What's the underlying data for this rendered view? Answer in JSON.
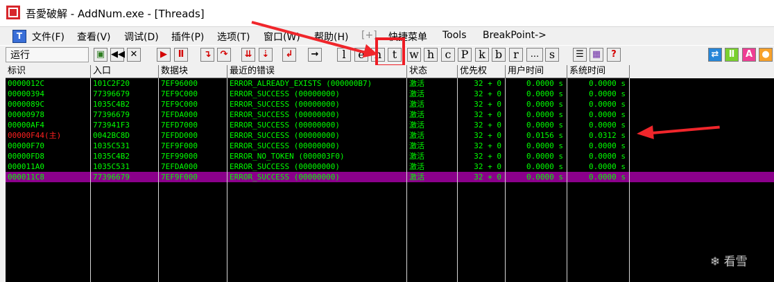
{
  "window": {
    "title": "吾愛破解 - AddNum.exe - [Threads]"
  },
  "menu": {
    "items": [
      "文件(F)",
      "查看(V)",
      "调试(D)",
      "插件(P)",
      "选项(T)",
      "窗口(W)",
      "帮助(H)",
      "[+]",
      "快捷菜单",
      "Tools",
      "BreakPoint->"
    ]
  },
  "toolbar": {
    "status": "运行",
    "letters": [
      "l",
      "e",
      "n",
      "t",
      "w",
      "h",
      "c",
      "P",
      "k",
      "b",
      "r",
      "...",
      "s"
    ]
  },
  "table": {
    "columns": [
      "标识",
      "入口",
      "数据块",
      "最近的错误",
      "状态",
      "优先权",
      "用户时间",
      "系统时间"
    ],
    "rows": [
      {
        "id": "0000012C",
        "entry": "101C2F20",
        "teb": "7EF96000",
        "error": "ERROR_ALREADY_EXISTS (000000B7)",
        "status": "激活",
        "priority": "32 + 0",
        "user": "0.0000 s",
        "sys": "0.0000 s",
        "main": false,
        "selected": false
      },
      {
        "id": "00000394",
        "entry": "77396679",
        "teb": "7EF9C000",
        "error": "ERROR_SUCCESS (00000000)",
        "status": "激活",
        "priority": "32 + 0",
        "user": "0.0000 s",
        "sys": "0.0000 s",
        "main": false,
        "selected": false
      },
      {
        "id": "0000089C",
        "entry": "1035C4B2",
        "teb": "7EF9C000",
        "error": "ERROR_SUCCESS (00000000)",
        "status": "激活",
        "priority": "32 + 0",
        "user": "0.0000 s",
        "sys": "0.0000 s",
        "main": false,
        "selected": false
      },
      {
        "id": "00000978",
        "entry": "77396679",
        "teb": "7EFDA000",
        "error": "ERROR_SUCCESS (00000000)",
        "status": "激活",
        "priority": "32 + 0",
        "user": "0.0000 s",
        "sys": "0.0000 s",
        "main": false,
        "selected": false
      },
      {
        "id": "00000AF4",
        "entry": "773941F3",
        "teb": "7EFD7000",
        "error": "ERROR_SUCCESS (00000000)",
        "status": "激活",
        "priority": "32 + 0",
        "user": "0.0000 s",
        "sys": "0.0000 s",
        "main": false,
        "selected": false
      },
      {
        "id": "00000F44(主)",
        "entry": "0042BC8D",
        "teb": "7EFDD000",
        "error": "ERROR_SUCCESS (00000000)",
        "status": "激活",
        "priority": "32 + 0",
        "user": "0.0156 s",
        "sys": "0.0312 s",
        "main": true,
        "selected": false
      },
      {
        "id": "00000F70",
        "entry": "1035C531",
        "teb": "7EF9F000",
        "error": "ERROR_SUCCESS (00000000)",
        "status": "激活",
        "priority": "32 + 0",
        "user": "0.0000 s",
        "sys": "0.0000 s",
        "main": false,
        "selected": false
      },
      {
        "id": "00000FD8",
        "entry": "1035C4B2",
        "teb": "7EF99000",
        "error": "ERROR_NO_TOKEN (000003F0)",
        "status": "激活",
        "priority": "32 + 0",
        "user": "0.0000 s",
        "sys": "0.0000 s",
        "main": false,
        "selected": false
      },
      {
        "id": "000011A0",
        "entry": "1035C531",
        "teb": "7EFDA000",
        "error": "ERROR_SUCCESS (00000000)",
        "status": "激活",
        "priority": "32 + 0",
        "user": "0.0000 s",
        "sys": "0.0000 s",
        "main": false,
        "selected": false
      },
      {
        "id": "000011C8",
        "entry": "77396679",
        "teb": "7EF9F000",
        "error": "ERROR_SUCCESS (00000000)",
        "status": "激活",
        "priority": "32 + 0",
        "user": "0.0000 s",
        "sys": "0.0000 s",
        "main": false,
        "selected": true
      }
    ]
  },
  "colors": {
    "text": "#00ff00",
    "main_thread": "#ff2020",
    "selected_row": "#8b008b",
    "annotation": "#ee1c24"
  },
  "watermark": "看雪"
}
